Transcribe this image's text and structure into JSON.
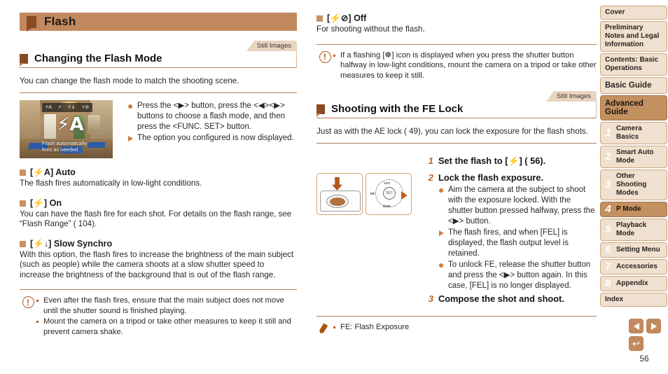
{
  "header": {
    "title": "Flash",
    "tick_icon": "square-marker-icon"
  },
  "page_number": "56",
  "still_images_tag": "Still Images",
  "section_flash_mode": {
    "title": "Changing the Flash Mode",
    "intro": "You can change the flash mode to match the shooting scene.",
    "lcd": {
      "icons": [
        "⚡A",
        "⚡",
        "⚡↓",
        "⚡⊘"
      ],
      "big_label": "⚡A",
      "caption_line1": "Flash automatically",
      "caption_line2": "fires as needed"
    },
    "steps": [
      {
        "type": "dot",
        "text": "Press the <▶> button, press the <◀><▶> buttons to choose a flash mode, and then press the <FUNC. SET> button."
      },
      {
        "type": "tri",
        "text": "The option you configured is now displayed."
      }
    ],
    "modes": [
      {
        "label": "[⚡A] Auto",
        "body": "The flash fires automatically in low-light conditions."
      },
      {
        "label": "[⚡] On",
        "body": "You can have the flash fire for each shot. For details on the flash range, see “Flash Range” ( 104)."
      },
      {
        "label": "[⚡↓] Slow Synchro",
        "body": "With this option, the flash fires to increase the brightness of the main subject (such as people) while the camera shoots at a slow shutter speed to increase the brightness of the background that is out of the flash range."
      }
    ],
    "caution": {
      "icon": "caution-icon",
      "items": [
        "Even after the flash fires, ensure that the main subject does not move until the shutter sound is finished playing.",
        "Mount the camera on a tripod or take other measures to keep it still and prevent camera shake."
      ]
    }
  },
  "section_off_mode": {
    "label": "[⚡⊘] Off",
    "body": "For shooting without the flash.",
    "caution": {
      "icon": "caution-icon",
      "items": [
        "If a flashing [☸] icon is displayed when you press the shutter button halfway in low-light conditions, mount the camera on a tripod or take other measures to keep it still."
      ]
    }
  },
  "section_fe_lock": {
    "title": "Shooting with the FE Lock",
    "intro": "Just as with the AE lock ( 49), you can lock the exposure for the flash shots.",
    "figures": [
      {
        "name": "shutter-button-illustration",
        "caption": ""
      },
      {
        "name": "control-dial-illustration",
        "caption": ""
      }
    ],
    "dial_labels": [
      "ISO",
      "FUNC. SET",
      "DISP.",
      "MF"
    ],
    "steps": [
      {
        "num": "1",
        "title": "Set the flash to [⚡] ( 56).",
        "bullets": []
      },
      {
        "num": "2",
        "title": "Lock the flash exposure.",
        "bullets": [
          {
            "type": "dot",
            "text": "Aim the camera at the subject to shoot with the exposure locked. With the shutter button pressed halfway, press the <▶> button."
          },
          {
            "type": "tri",
            "text": "The flash fires, and when [FEL] is displayed, the flash output level is retained."
          },
          {
            "type": "dot",
            "text": "To unlock FE, release the shutter button and press the <▶> button again. In this case, [FEL] is no longer displayed."
          }
        ]
      },
      {
        "num": "3",
        "title": "Compose the shot and shoot.",
        "bullets": []
      }
    ],
    "note": {
      "icon": "pencil-icon",
      "items": [
        "FE: Flash Exposure"
      ]
    }
  },
  "sidebar": {
    "items": [
      {
        "label": "Cover",
        "kind": "plain",
        "active": false
      },
      {
        "label": "Preliminary Notes and Legal Information",
        "kind": "plain",
        "active": false
      },
      {
        "label": "Contents: Basic Operations",
        "kind": "plain",
        "active": false
      },
      {
        "label": "Basic Guide",
        "kind": "big",
        "active": false
      },
      {
        "label": "Advanced Guide",
        "kind": "big",
        "active": true
      },
      {
        "label": "Camera Basics",
        "kind": "chapter",
        "num": "1",
        "active": false
      },
      {
        "label": "Smart Auto Mode",
        "kind": "chapter",
        "num": "2",
        "active": false
      },
      {
        "label": "Other Shooting Modes",
        "kind": "chapter",
        "num": "3",
        "active": false
      },
      {
        "label": "P Mode",
        "kind": "chapter",
        "num": "4",
        "active": true
      },
      {
        "label": "Playback Mode",
        "kind": "chapter",
        "num": "5",
        "active": false
      },
      {
        "label": "Setting Menu",
        "kind": "chapter",
        "num": "6",
        "active": false
      },
      {
        "label": "Accessories",
        "kind": "chapter",
        "num": "7",
        "active": false
      },
      {
        "label": "Appendix",
        "kind": "chapter",
        "num": "8",
        "active": false
      },
      {
        "label": "Index",
        "kind": "plain",
        "active": false
      }
    ]
  },
  "pagenav": {
    "prev_icon": "triangle-left-icon",
    "next_icon": "triangle-right-icon",
    "back_icon": "return-arrow-icon",
    "back_glyph": "↩"
  },
  "colors": {
    "accent": "#c3895e",
    "accent_dark": "#8a4b23",
    "bullet": "#d07b3c",
    "tab_bg": "#e8d5c0",
    "sidebar_bg": "#efe0cf",
    "sidebar_active": "#c3905f",
    "rule": "#b07f55"
  }
}
